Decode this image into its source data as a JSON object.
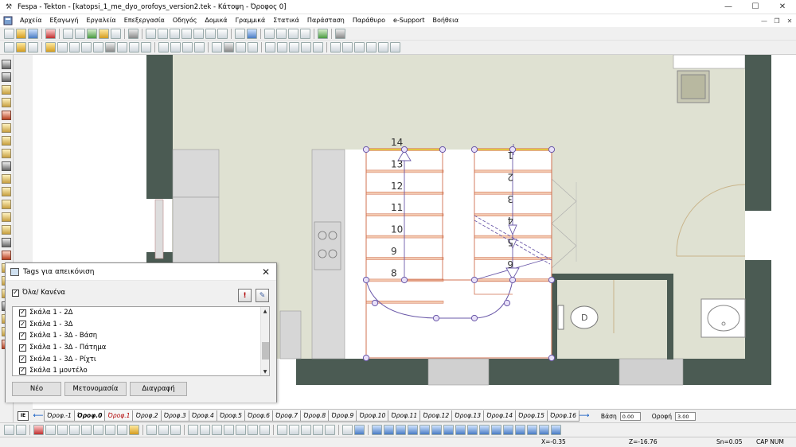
{
  "window": {
    "title": "Fespa - Tekton - [katopsi_1_me_dyo_orofoys_version2.tek - Κάτοψη - Όροφος 0]",
    "minimize_glyph": "—",
    "maximize_glyph": "☐",
    "close_glyph": "✕"
  },
  "menu": {
    "items": [
      "Αρχεία",
      "Εξαγωγή",
      "Εργαλεία",
      "Επεξεργασία",
      "Οδηγός",
      "Δομικά",
      "Γραμμικά",
      "Στατικά",
      "Παράσταση",
      "Παράθυρο",
      "e-Support",
      "Βοήθεια"
    ],
    "mdi_min": "—",
    "mdi_restore": "❐",
    "mdi_close": "✕"
  },
  "drawing": {
    "stair_left_numbers": [
      "14",
      "13",
      "12",
      "11",
      "10",
      "9",
      "8"
    ],
    "stair_right_numbers": [
      "1",
      "2",
      "3",
      "4",
      "5",
      "6"
    ],
    "colors": {
      "wall": "#4b5b53",
      "floor": "#dfe1d2",
      "stair_line": "#d07050",
      "stair_fill": "#ffffff",
      "node": "#6a58a8",
      "appliance": "#d6d6d6"
    }
  },
  "dialog": {
    "title": "Tags για απεικόνιση",
    "close_glyph": "✕",
    "all_none_label": "Όλα/ Κανένα",
    "tags": [
      "Σκάλα 1 - 2Δ",
      "Σκάλα 1 - 3Δ",
      "Σκάλα 1 - 3Δ - Βάση",
      "Σκάλα 1 - 3Δ - Πάτημα",
      "Σκάλα 1 - 3Δ - Ρίχτι",
      "Σκάλα 1 μοντέλο"
    ],
    "check_glyph": "✓",
    "buttons": {
      "new": "Νέο",
      "rename": "Μετονομασία",
      "delete": "Διαγραφή"
    }
  },
  "floors": {
    "tabs": [
      "Όροφ.-1",
      "Όροφ.0",
      "Όροφ.1",
      "Όροφ.2",
      "Όροφ.3",
      "Όροφ.4",
      "Όροφ.5",
      "Όροφ.6",
      "Όροφ.7",
      "Όροφ.8",
      "Όροφ.9",
      "Όροφ.10",
      "Όροφ.11",
      "Όροφ.12",
      "Όροφ.13",
      "Όροφ.14",
      "Όροφ.15",
      "Όροφ.16"
    ],
    "active": "Όροφ.0",
    "base_label": "Βάση",
    "base_value": "0.00",
    "roof_label": "Οροφή",
    "roof_value": "3.00",
    "lefttab_glyph": "IE"
  },
  "status": {
    "x": "X=-0.35",
    "z": "Z=-16.76",
    "sn": "Sn=0.05",
    "mode": "CAP NUM"
  }
}
